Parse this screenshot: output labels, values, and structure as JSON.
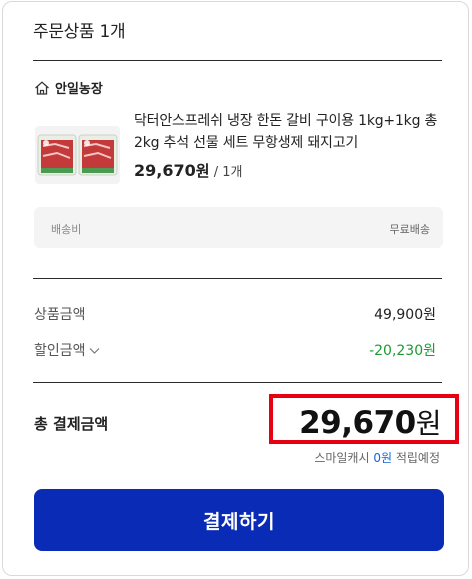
{
  "header": {
    "title": "주문상품 1개"
  },
  "seller": {
    "name": "안일농장",
    "icon": "store-home-icon"
  },
  "product": {
    "name": "닥터안스프레쉬 냉장 한돈 갈비 구이용 1kg+1kg 총2kg 추석 선물 세트 무항생제 돼지고기",
    "price": "29,670",
    "price_unit": "원",
    "quantity": " / 1개"
  },
  "shipping": {
    "label": "배송비",
    "value": "무료배송"
  },
  "summary": {
    "product_amount_label": "상품금액",
    "product_amount_value": "49,900원",
    "discount_label": "할인금액",
    "discount_value": "-20,230원"
  },
  "total": {
    "label": "총 결제금액",
    "amount": "29,670",
    "unit": "원",
    "cash_prefix": "스마일캐시 ",
    "cash_amount": "0원",
    "cash_suffix": " 적립예정"
  },
  "pay_button": {
    "label": "결제하기"
  },
  "colors": {
    "accent_button": "#0a2bb6",
    "discount": "#1a9b32",
    "highlight_box": "#e60012",
    "cash_link": "#1266e0"
  }
}
